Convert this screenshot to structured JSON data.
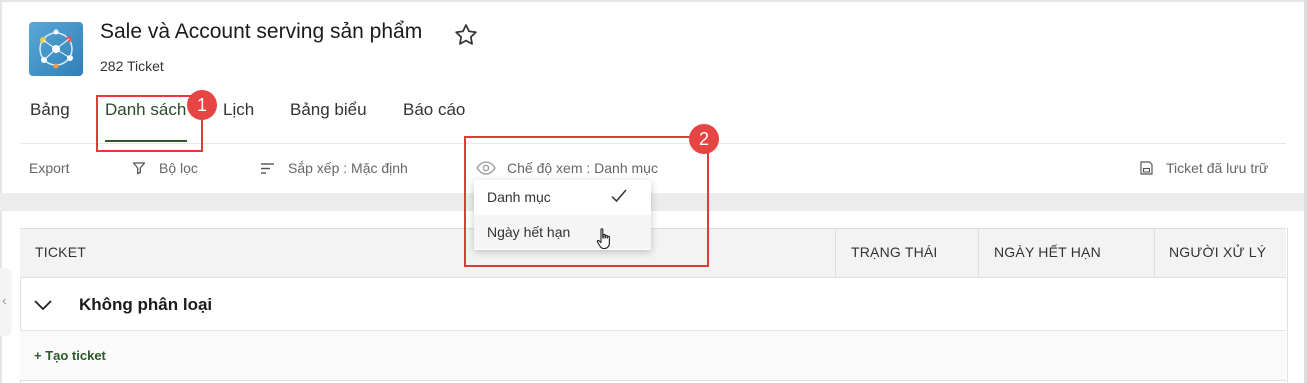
{
  "header": {
    "title": "Sale và Account serving sản phẩm",
    "subtitle": "282 Ticket",
    "favorite_icon": "star-outline-icon",
    "app_icon": "network-globe-app-icon"
  },
  "tabs": [
    {
      "label": "Bảng",
      "active": false
    },
    {
      "label": "Danh sách",
      "active": true
    },
    {
      "label": "Lịch",
      "active": false
    },
    {
      "label": "Bảng biểu",
      "active": false
    },
    {
      "label": "Báo cáo",
      "active": false
    }
  ],
  "toolbar": {
    "export": "Export",
    "filter": "Bộ lọc",
    "sort": "Sắp xếp : Mặc định",
    "view_mode": "Chế độ xem : Danh mục",
    "archived": "Ticket đã lưu trữ"
  },
  "view_dropdown": {
    "options": [
      {
        "label": "Danh mục",
        "selected": true
      },
      {
        "label": "Ngày hết hạn",
        "selected": false
      }
    ]
  },
  "table": {
    "columns": [
      "TICKET",
      "TRẠNG THÁI",
      "NGÀY HẾT HẠN",
      "NGƯỜI XỬ LÝ"
    ],
    "group": "Không phân loại",
    "create_label": "+ Tạo ticket"
  },
  "annotations": {
    "badge_1": "1",
    "badge_2": "2",
    "color": "#e23a3a"
  },
  "colors": {
    "accent_green": "#2f5a2f",
    "annotation_red": "#e74444"
  }
}
